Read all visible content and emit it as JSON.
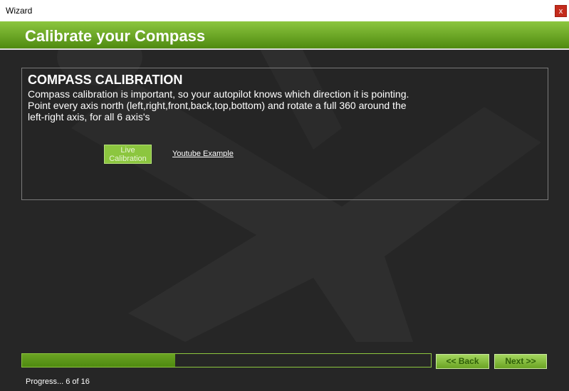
{
  "window": {
    "title": "Wizard",
    "close_label": "x"
  },
  "header": {
    "title": "Calibrate your Compass"
  },
  "panel": {
    "title": "COMPASS CALIBRATION",
    "description": "Compass calibration is important, so your autopilot knows which direction it is pointing. Point every axis north (left,right,front,back,top,bottom) and rotate a full 360 around the left-right axis, for all 6 axis's",
    "live_button": "Live Calibration",
    "youtube_link": "Youtube Example"
  },
  "progress": {
    "label": "Progress... 6 of 16",
    "current": 6,
    "total": 16
  },
  "nav": {
    "back_label": "<< Back",
    "next_label": "Next >>"
  },
  "colors": {
    "accent": "#8cc63f",
    "accent_dark": "#4f8a10",
    "background": "#262626"
  },
  "icons": {
    "watermark": "plane-silhouette-icon"
  }
}
